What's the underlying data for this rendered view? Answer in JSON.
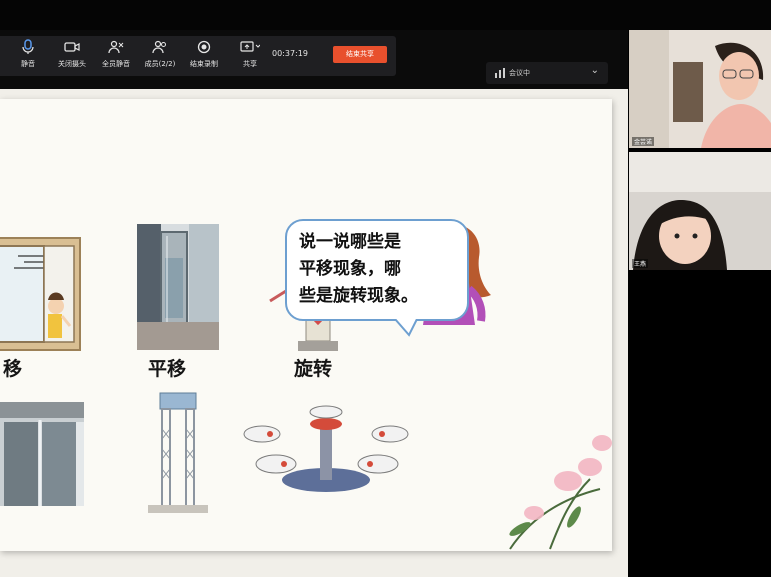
{
  "toolbar": {
    "buttons": [
      {
        "label": "静音",
        "icon": "microphone-icon"
      },
      {
        "label": "关闭摄头",
        "icon": "camera-icon"
      },
      {
        "label": "全员静音",
        "icon": "users-mute-icon"
      },
      {
        "label": "成员(2/2)",
        "icon": "members-icon"
      },
      {
        "label": "结束录制",
        "icon": "record-stop-icon"
      },
      {
        "label": "共享",
        "icon": "share-screen-icon"
      }
    ],
    "timer": "00:37:19",
    "end_share": "结束共享"
  },
  "meeting_status": {
    "text": "会议中"
  },
  "slide": {
    "bubble_text": "说一说哪些是\n平移现象，哪\n些是旋转现象。",
    "labels": {
      "window": "移",
      "elevator": "平移",
      "ride": "旋转"
    }
  },
  "participants": [
    {
      "name": "金芸诺"
    },
    {
      "name": "王燕"
    }
  ],
  "colors": {
    "accent": "#e8502d",
    "bubble_border": "#6d9fd0"
  }
}
